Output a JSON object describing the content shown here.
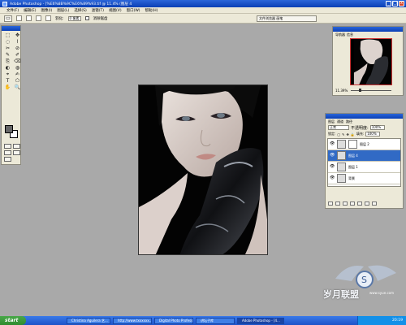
{
  "window": {
    "title": "Adobe Photoshop - [%E6%8B%9C%E6%89%93.tif @ 11.4% (图层 4, RGB)]",
    "min": "_",
    "max": "□",
    "close": "x"
  },
  "menu": [
    "文件(F)",
    "编辑(E)",
    "图像(I)",
    "图层(L)",
    "选择(S)",
    "滤镜(T)",
    "视图(V)",
    "窗口(W)",
    "帮助(H)"
  ],
  "options": {
    "tool_icon": "▭",
    "feather_label": "羽化:",
    "feather_value": "0 像素",
    "antialias_label": "消除锯齿",
    "well_label": "文件浏览器  画笔"
  },
  "tools": [
    "⬚",
    "✥",
    "◌",
    "⌇",
    "✂",
    "⊘",
    "✎",
    "✐",
    "⎘",
    "⌫",
    "◐",
    "◍",
    "⌖",
    "✍",
    "T",
    "⬠",
    "✋",
    "🔍"
  ],
  "navigator": {
    "tab1": "导航器",
    "tab2": "信息",
    "zoom": "11.39%"
  },
  "layers": {
    "tab1": "图层",
    "tab2": "通道",
    "tab3": "路径",
    "blend_mode": "正常",
    "opacity_label": "不透明度:",
    "opacity_value": "100%",
    "lock_label": "锁定:",
    "fill_label": "填充:",
    "fill_value": "100%",
    "items": [
      {
        "name": "图层 2"
      },
      {
        "name": "图层 4"
      },
      {
        "name": "图层 1"
      },
      {
        "name": "背景"
      }
    ]
  },
  "watermark": {
    "text": "岁月联盟",
    "sub": "www.syue.com"
  },
  "taskbar": {
    "start": "start",
    "tasks": [
      "Christina Aguilera 艺...",
      "http://www.txxxxxx...",
      "Digital Photo Professio...",
      "讲坛子库",
      "Adobe Photoshop - [4..."
    ],
    "clock": "20:19"
  },
  "colors": {
    "titlebar": "#0a3fb5",
    "selected_layer": "#316ac5",
    "taskbar": "#245edb"
  }
}
